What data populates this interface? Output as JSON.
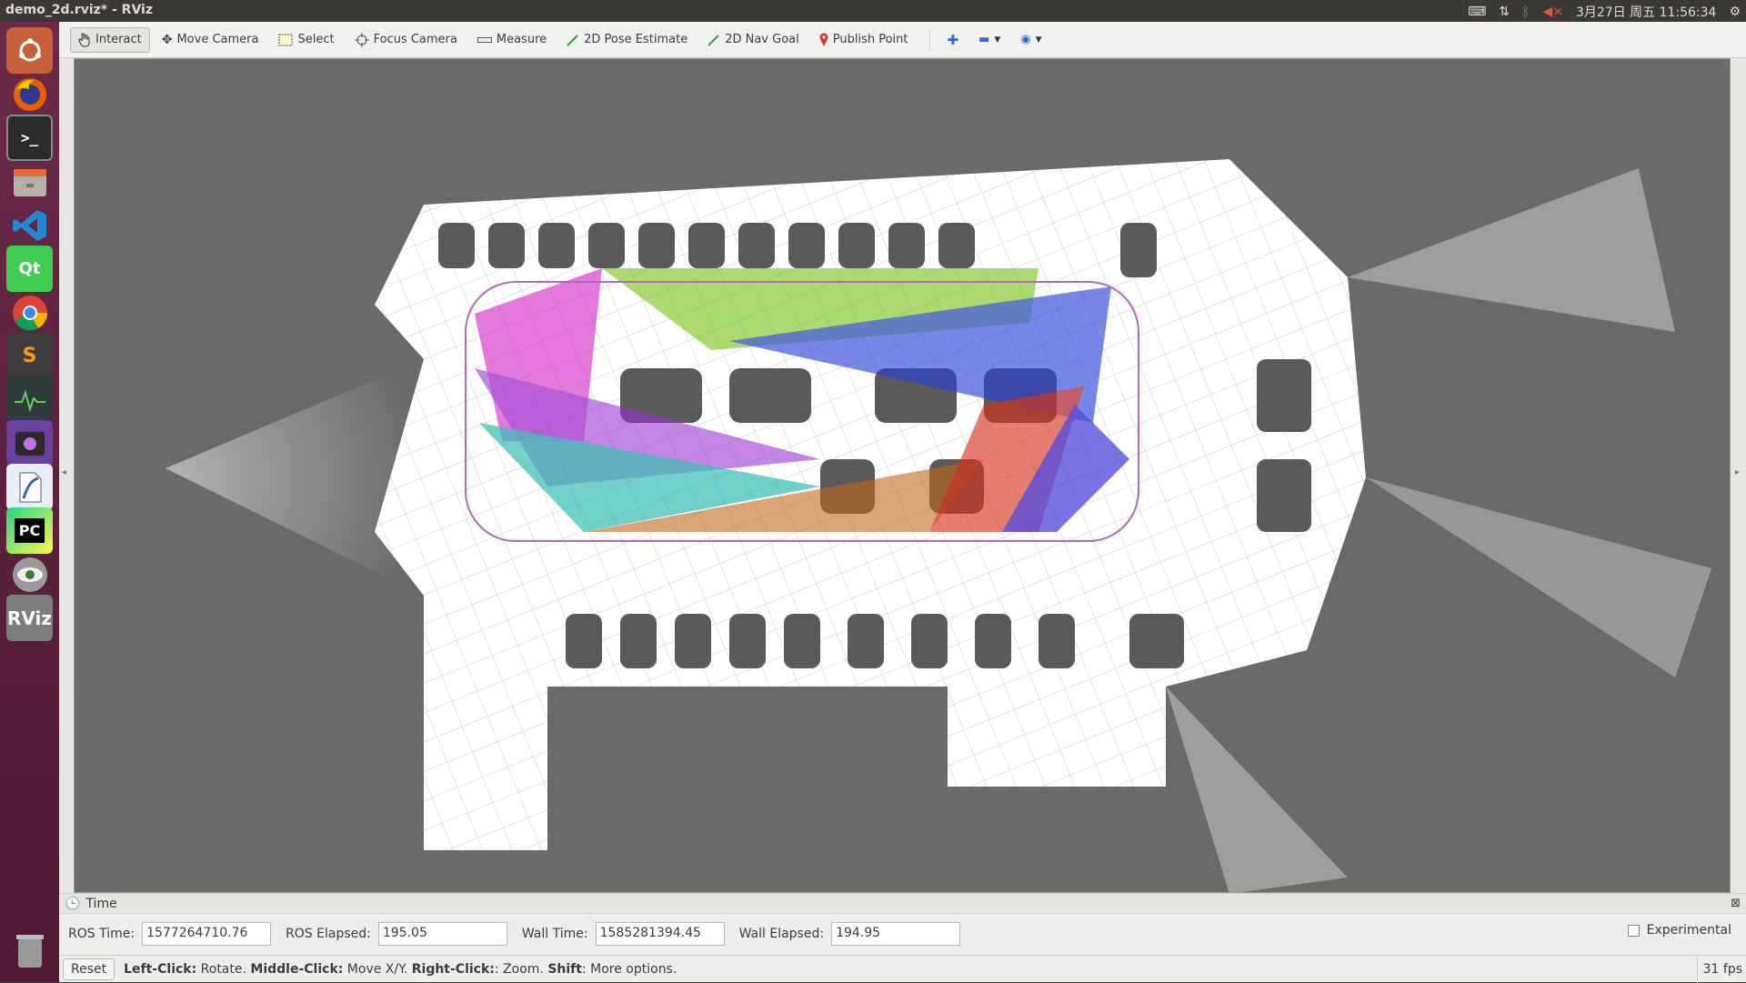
{
  "window_title": "demo_2d.rviz* - RViz",
  "tray": {
    "datetime": "3月27日 周五 11:56:34"
  },
  "toolbar": {
    "tools": [
      {
        "label": "Interact",
        "icon": "hand-icon"
      },
      {
        "label": "Move Camera",
        "icon": "move-camera-icon"
      },
      {
        "label": "Select",
        "icon": "select-icon"
      },
      {
        "label": "Focus Camera",
        "icon": "focus-camera-icon"
      },
      {
        "label": "Measure",
        "icon": "measure-icon"
      },
      {
        "label": "2D Pose Estimate",
        "icon": "pose-arrow-icon"
      },
      {
        "label": "2D Nav Goal",
        "icon": "nav-goal-arrow-icon"
      },
      {
        "label": "Publish Point",
        "icon": "map-pin-icon"
      }
    ]
  },
  "launcher": {
    "items": [
      "ubuntu-dash-icon",
      "firefox-icon",
      "terminal-icon",
      "files-icon",
      "vscode-icon",
      "qt-creator-icon",
      "chrome-icon",
      "sublime-icon",
      "system-monitor-icon",
      "video-icon",
      "libreoffice-icon",
      "pycharm-icon",
      "eye-app-icon",
      "rviz-icon",
      "trash-icon"
    ],
    "qt_label": "Qt",
    "pc_label": "PC",
    "rviz_label": "RViz",
    "sublime_label": "S"
  },
  "time_panel": {
    "title": "Time",
    "ros_time_label": "ROS Time:",
    "ros_time": "1577264710.76",
    "ros_elapsed_label": "ROS Elapsed:",
    "ros_elapsed": "195.05",
    "wall_time_label": "Wall Time:",
    "wall_time": "1585281394.45",
    "wall_elapsed_label": "Wall Elapsed:",
    "wall_elapsed": "194.95",
    "experimental_label": "Experimental"
  },
  "status": {
    "reset_label": "Reset",
    "left_click": "Left-Click:",
    "left_desc": " Rotate. ",
    "middle_click": "Middle-Click:",
    "middle_desc": " Move X/Y. ",
    "right_click": "Right-Click:",
    "right_desc": ": Zoom. ",
    "shift": "Shift",
    "shift_desc": ": More options.",
    "fps": "31 fps"
  }
}
